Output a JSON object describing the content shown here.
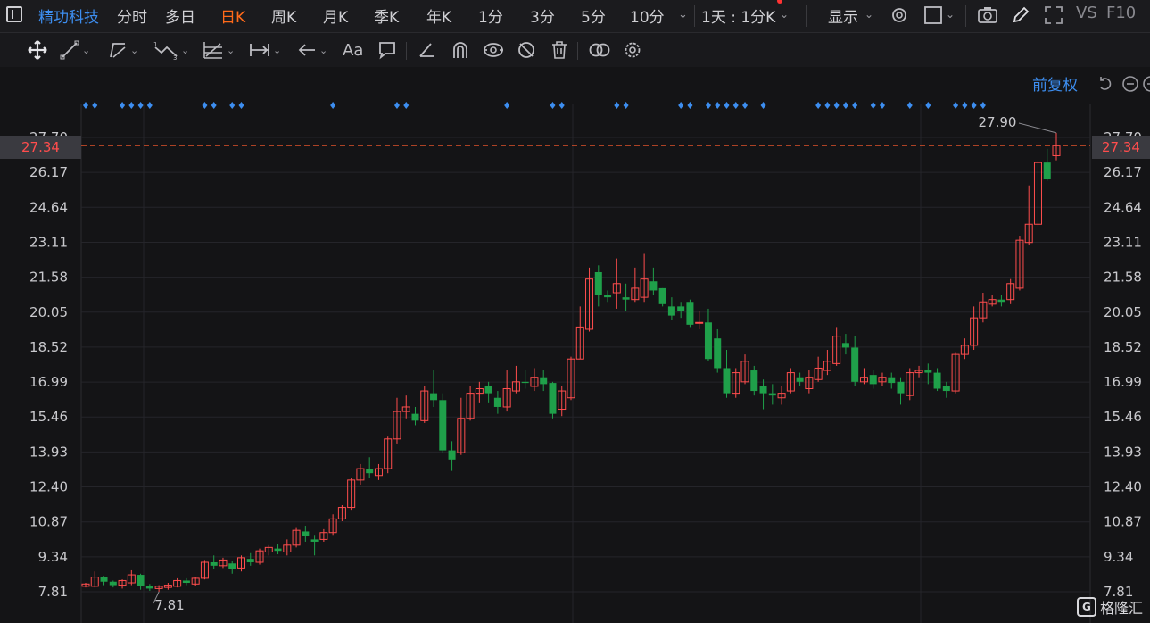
{
  "header": {
    "panel_icon": "panel-icon",
    "stock_name": "精功科技",
    "tabs": [
      "分时",
      "多日",
      "日K",
      "周K",
      "月K",
      "季K",
      "年K",
      "1分",
      "3分",
      "5分",
      "10分"
    ],
    "active_tab": "日K",
    "period_selector": "1天 : 1分K",
    "display_label": "显示",
    "vs_label": "VS",
    "f10_label": "F10"
  },
  "toolbar": {
    "icons": [
      "move-icon",
      "line-icon",
      "polyline-icon",
      "wave-icon",
      "fibonacci-icon",
      "range-icon",
      "arrow-icon",
      "text-icon",
      "comment-icon",
      "angle-icon",
      "magnet-icon",
      "eye-icon",
      "hide-icon",
      "trash-icon",
      "link-icon",
      "settings-icon"
    ],
    "text_tool_label": "Aa"
  },
  "chart": {
    "adjust_label": "前复权",
    "current_price": "27.34",
    "max_label": "27.90",
    "min_label": "7.81",
    "accent_up": "#ff4d4d",
    "accent_down": "#1fa04a",
    "accent_blue": "#3d8ef0"
  },
  "watermark": {
    "logo_char": "G",
    "text": "格隆汇"
  },
  "chart_data": {
    "type": "candlestick",
    "yticks": [
      7.81,
      9.34,
      10.87,
      12.4,
      13.93,
      15.46,
      16.99,
      18.52,
      20.05,
      21.58,
      23.11,
      24.64,
      26.17,
      27.7
    ],
    "ytick_labels": [
      "7.81",
      "9.34",
      "10.87",
      "12.40",
      "13.93",
      "15.46",
      "16.99",
      "18.52",
      "20.05",
      "21.58",
      "23.11",
      "24.64",
      "26.17",
      "27.70"
    ],
    "ylim": [
      7.81,
      27.7
    ],
    "current_price": 27.34,
    "max_price": 27.9,
    "min_price": 7.81,
    "candles": [
      [
        8.05,
        8.15,
        8.0,
        8.2
      ],
      [
        8.05,
        8.45,
        8.0,
        8.7
      ],
      [
        8.45,
        8.25,
        8.1,
        8.5
      ],
      [
        8.25,
        8.1,
        8.0,
        8.3
      ],
      [
        8.1,
        8.3,
        7.95,
        8.35
      ],
      [
        8.2,
        8.55,
        8.1,
        8.75
      ],
      [
        8.55,
        8.05,
        7.9,
        8.6
      ],
      [
        8.05,
        7.95,
        7.85,
        8.15
      ],
      [
        7.95,
        8.05,
        7.81,
        8.1
      ],
      [
        8.0,
        8.1,
        7.9,
        8.2
      ],
      [
        8.05,
        8.3,
        8.0,
        8.4
      ],
      [
        8.3,
        8.2,
        8.1,
        8.4
      ],
      [
        8.15,
        8.4,
        8.05,
        8.45
      ],
      [
        8.4,
        9.1,
        8.35,
        9.2
      ],
      [
        9.1,
        8.95,
        8.8,
        9.4
      ],
      [
        8.95,
        9.2,
        8.85,
        9.3
      ],
      [
        9.05,
        8.8,
        8.6,
        9.15
      ],
      [
        8.85,
        9.3,
        8.7,
        9.4
      ],
      [
        9.25,
        9.1,
        8.95,
        9.5
      ],
      [
        9.1,
        9.6,
        9.0,
        9.7
      ],
      [
        9.55,
        9.75,
        9.4,
        9.85
      ],
      [
        9.7,
        9.6,
        9.45,
        9.9
      ],
      [
        9.55,
        9.85,
        9.4,
        10.1
      ],
      [
        9.85,
        10.5,
        9.75,
        10.6
      ],
      [
        10.45,
        10.25,
        10.0,
        10.7
      ],
      [
        10.1,
        10.0,
        9.4,
        10.3
      ],
      [
        10.1,
        10.4,
        10.0,
        10.55
      ],
      [
        10.4,
        11.0,
        10.3,
        11.2
      ],
      [
        11.0,
        11.5,
        10.9,
        11.6
      ],
      [
        11.5,
        12.7,
        11.4,
        12.8
      ],
      [
        12.7,
        13.2,
        12.5,
        13.4
      ],
      [
        13.2,
        13.0,
        12.8,
        13.7
      ],
      [
        12.9,
        13.2,
        12.7,
        13.4
      ],
      [
        13.2,
        14.5,
        13.0,
        14.6
      ],
      [
        14.5,
        15.7,
        14.3,
        16.3
      ],
      [
        15.7,
        15.9,
        15.4,
        16.4
      ],
      [
        15.6,
        15.3,
        15.1,
        15.9
      ],
      [
        15.3,
        16.6,
        15.2,
        16.8
      ],
      [
        16.5,
        16.2,
        15.9,
        17.5
      ],
      [
        16.2,
        14.0,
        13.9,
        16.5
      ],
      [
        14.0,
        13.6,
        13.1,
        14.4
      ],
      [
        13.9,
        15.4,
        13.8,
        16.3
      ],
      [
        15.4,
        16.5,
        15.3,
        16.8
      ],
      [
        16.5,
        16.7,
        16.1,
        17.0
      ],
      [
        16.8,
        16.5,
        16.1,
        17.0
      ],
      [
        16.3,
        15.9,
        15.6,
        16.6
      ],
      [
        15.9,
        16.7,
        15.7,
        17.5
      ],
      [
        16.6,
        17.0,
        16.5,
        17.7
      ],
      [
        17.0,
        16.95,
        16.7,
        17.5
      ],
      [
        16.8,
        17.2,
        16.6,
        17.6
      ],
      [
        17.2,
        16.9,
        16.6,
        17.5
      ],
      [
        16.95,
        15.6,
        15.4,
        17.0
      ],
      [
        15.8,
        16.6,
        15.5,
        16.8
      ],
      [
        16.3,
        18.0,
        16.2,
        18.1
      ],
      [
        18.0,
        19.4,
        18.0,
        20.3
      ],
      [
        19.3,
        21.5,
        19.2,
        22.0
      ],
      [
        21.8,
        20.8,
        20.3,
        22.1
      ],
      [
        20.8,
        20.7,
        20.5,
        21.0
      ],
      [
        20.9,
        21.3,
        20.2,
        22.4
      ],
      [
        20.7,
        20.6,
        20.1,
        21.3
      ],
      [
        20.6,
        21.1,
        20.5,
        22.0
      ],
      [
        20.7,
        21.5,
        20.5,
        22.6
      ],
      [
        21.4,
        21.0,
        20.8,
        22.0
      ],
      [
        21.1,
        20.4,
        20.3,
        21.1
      ],
      [
        20.3,
        19.9,
        19.7,
        20.7
      ],
      [
        20.3,
        20.1,
        19.8,
        20.5
      ],
      [
        20.5,
        19.5,
        19.4,
        20.6
      ],
      [
        19.6,
        19.6,
        19.3,
        20.1
      ],
      [
        19.6,
        18.0,
        17.9,
        20.2
      ],
      [
        18.9,
        17.6,
        17.4,
        19.3
      ],
      [
        17.6,
        16.5,
        16.3,
        18.4
      ],
      [
        16.5,
        17.4,
        16.3,
        17.6
      ],
      [
        17.0,
        17.9,
        16.9,
        18.2
      ],
      [
        17.5,
        16.6,
        16.4,
        17.7
      ],
      [
        16.8,
        16.5,
        15.8,
        17.1
      ],
      [
        16.5,
        16.4,
        16.0,
        16.9
      ],
      [
        16.3,
        16.5,
        16.0,
        16.8
      ],
      [
        16.6,
        17.4,
        16.5,
        17.6
      ],
      [
        17.2,
        17.0,
        16.8,
        17.4
      ],
      [
        16.7,
        17.2,
        16.5,
        17.5
      ],
      [
        17.1,
        17.6,
        17.0,
        18.1
      ],
      [
        17.5,
        17.9,
        17.3,
        18.4
      ],
      [
        17.8,
        19.0,
        17.7,
        19.4
      ],
      [
        18.7,
        18.5,
        18.2,
        19.1
      ],
      [
        18.5,
        17.0,
        16.8,
        19.0
      ],
      [
        17.0,
        17.2,
        16.9,
        17.6
      ],
      [
        17.3,
        16.9,
        16.7,
        17.5
      ],
      [
        17.0,
        17.2,
        16.8,
        17.4
      ],
      [
        17.2,
        16.95,
        16.7,
        17.4
      ],
      [
        17.0,
        16.5,
        16.0,
        17.2
      ],
      [
        16.4,
        17.4,
        16.2,
        17.6
      ],
      [
        17.4,
        17.5,
        17.2,
        17.7
      ],
      [
        17.5,
        17.4,
        16.9,
        17.8
      ],
      [
        17.4,
        16.7,
        16.6,
        17.6
      ],
      [
        16.8,
        16.6,
        16.3,
        17.0
      ],
      [
        16.6,
        18.2,
        16.5,
        18.3
      ],
      [
        18.2,
        18.6,
        18.0,
        18.9
      ],
      [
        18.6,
        19.8,
        18.4,
        20.3
      ],
      [
        19.8,
        20.5,
        19.6,
        20.9
      ],
      [
        20.4,
        20.6,
        20.3,
        20.8
      ],
      [
        20.6,
        20.5,
        20.3,
        20.8
      ],
      [
        20.6,
        21.3,
        20.4,
        21.5
      ],
      [
        21.1,
        23.2,
        21.0,
        23.4
      ],
      [
        23.1,
        23.9,
        23.0,
        25.6
      ],
      [
        23.9,
        26.6,
        23.8,
        26.7
      ],
      [
        26.6,
        25.9,
        25.8,
        27.2
      ],
      [
        26.9,
        27.34,
        26.7,
        27.9
      ]
    ],
    "up_markers": [
      0,
      1,
      4,
      5,
      6,
      7,
      13,
      14,
      16,
      17,
      27,
      34,
      35,
      46,
      51,
      52,
      58,
      59,
      65,
      66,
      68,
      69,
      70,
      71,
      72,
      74,
      80,
      81,
      82,
      83,
      84,
      86,
      87,
      90,
      92,
      95,
      96,
      97,
      98
    ]
  }
}
